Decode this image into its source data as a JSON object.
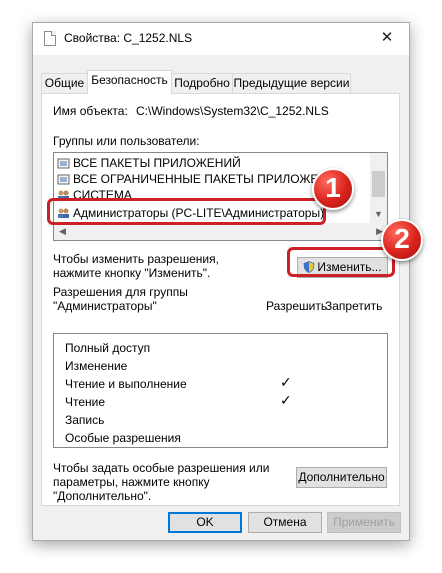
{
  "window": {
    "title": "Свойства: C_1252.NLS",
    "close_symbol": "✕"
  },
  "tabs": [
    {
      "label": "Общие",
      "active": false
    },
    {
      "label": "Безопасность",
      "active": true
    },
    {
      "label": "Подробно",
      "active": false
    },
    {
      "label": "Предыдущие версии",
      "active": false
    }
  ],
  "security": {
    "object_name_label": "Имя объекта:",
    "object_name_value": "C:\\Windows\\System32\\C_1252.NLS",
    "groups_label": "Группы или пользователи:",
    "groups": [
      {
        "name": "ВСЕ ПАКЕТЫ ПРИЛОЖЕНИЙ",
        "icon": "package-icon"
      },
      {
        "name": "ВСЕ ОГРАНИЧЕННЫЕ ПАКЕТЫ ПРИЛОЖЕНИ",
        "icon": "package-icon"
      },
      {
        "name": "СИСТЕМА",
        "icon": "users-icon"
      },
      {
        "name": "Администраторы (PC-LITE\\Администраторы)",
        "icon": "users-icon",
        "selected": true
      }
    ],
    "change_hint": "Чтобы изменить разрешения,\nнажмите кнопку \"Изменить\".",
    "change_button": "Изменить...",
    "perm_for_label": "Разрешения для группы\n\"Администраторы\"",
    "allow_header": "Разрешить",
    "deny_header": "Запретить",
    "permissions": [
      {
        "name": "Полный доступ",
        "allow": false
      },
      {
        "name": "Изменение",
        "allow": false
      },
      {
        "name": "Чтение и выполнение",
        "allow": true
      },
      {
        "name": "Чтение",
        "allow": true
      },
      {
        "name": "Запись",
        "allow": false
      },
      {
        "name": "Особые разрешения",
        "allow": false
      }
    ],
    "check_mark": "✓",
    "advanced_hint": "Чтобы задать особые разрешения или\nпараметры, нажмите кнопку\n\"Дополнительно\".",
    "advanced_button": "Дополнительно"
  },
  "footer": {
    "ok": "OK",
    "cancel": "Отмена",
    "apply": "Применить"
  },
  "annotations": {
    "badge1": "1",
    "badge2": "2",
    "color": "#cc1f26"
  }
}
